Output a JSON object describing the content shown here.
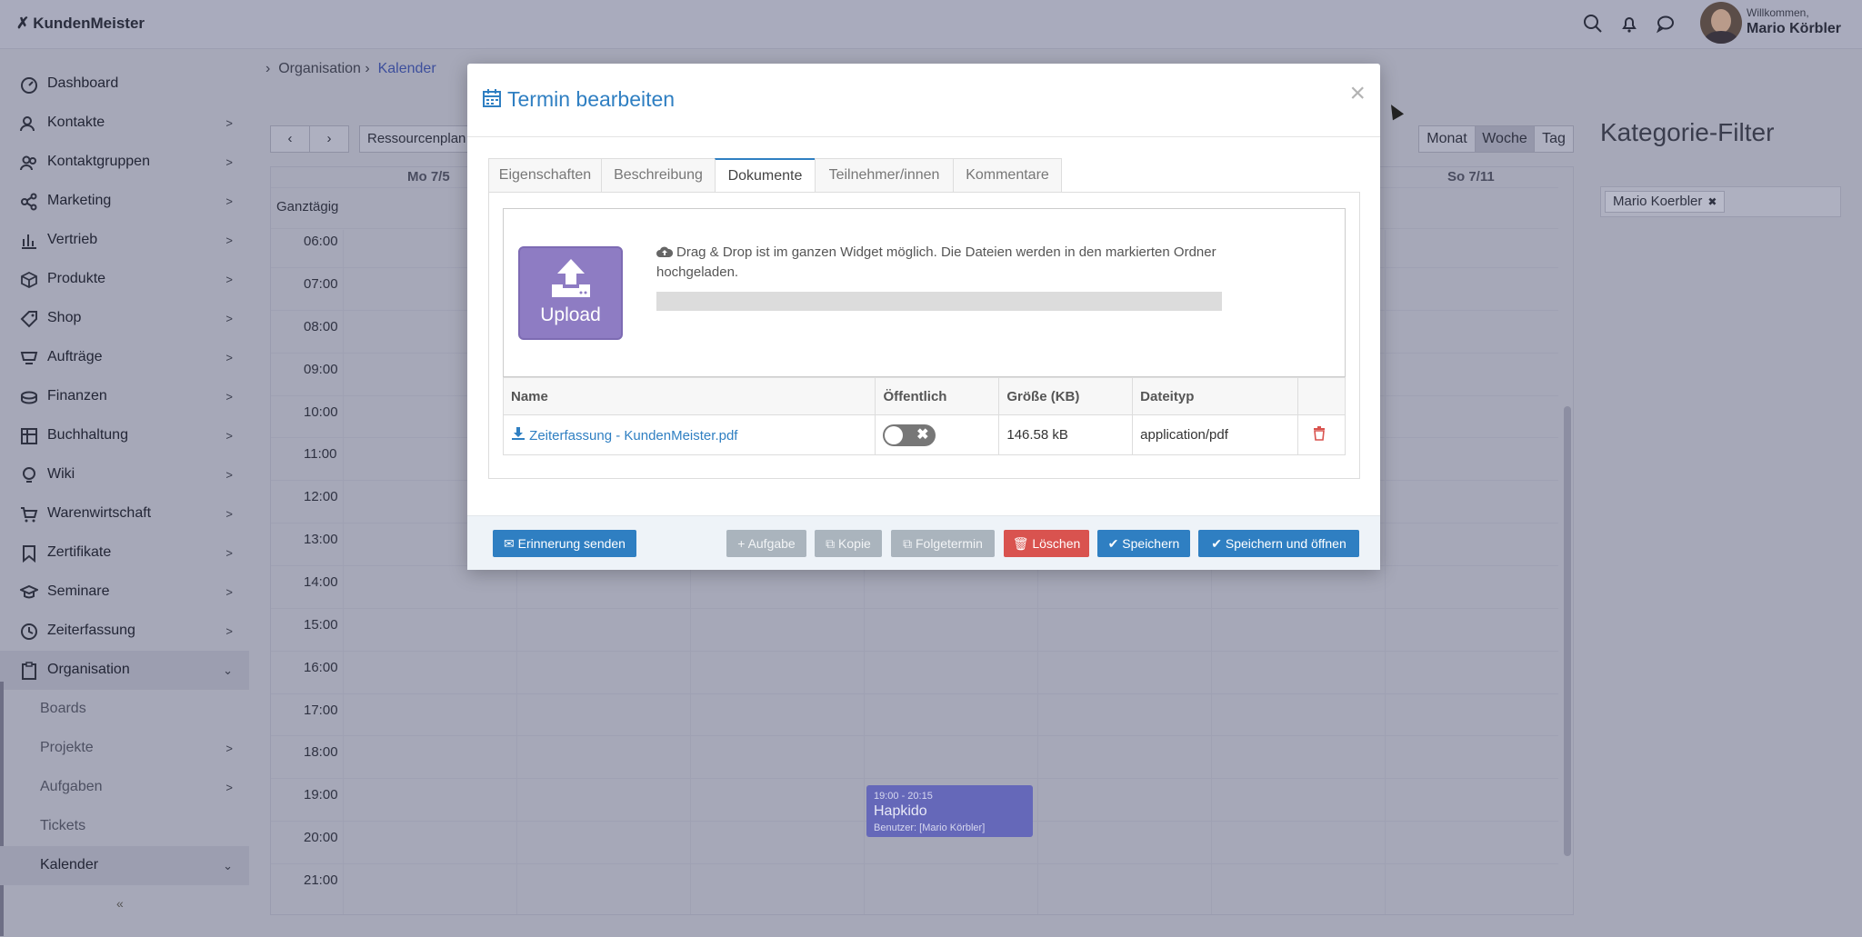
{
  "app": {
    "name": "KundenMeister"
  },
  "header": {
    "welcome": "Willkommen,",
    "user_name": "Mario Körbler",
    "icons": [
      "search-icon",
      "bell-icon",
      "chat-icon"
    ]
  },
  "sidebar": {
    "items": [
      {
        "label": "Dashboard",
        "icon": "dashboard-icon"
      },
      {
        "label": "Kontakte",
        "icon": "contacts-icon"
      },
      {
        "label": "Kontaktgruppen",
        "icon": "groups-icon"
      },
      {
        "label": "Marketing",
        "icon": "marketing-icon"
      },
      {
        "label": "Vertrieb",
        "icon": "chart-icon"
      },
      {
        "label": "Produkte",
        "icon": "box-icon"
      },
      {
        "label": "Shop",
        "icon": "tag-icon"
      },
      {
        "label": "Aufträge",
        "icon": "orders-icon"
      },
      {
        "label": "Finanzen",
        "icon": "coins-icon"
      },
      {
        "label": "Buchhaltung",
        "icon": "table-icon"
      },
      {
        "label": "Wiki",
        "icon": "bulb-icon"
      },
      {
        "label": "Warenwirtschaft",
        "icon": "cart-icon"
      },
      {
        "label": "Zertifikate",
        "icon": "bookmark-icon"
      },
      {
        "label": "Seminare",
        "icon": "graduation-icon"
      },
      {
        "label": "Zeiterfassung",
        "icon": "clock-icon"
      },
      {
        "label": "Organisation",
        "icon": "clipboard-icon"
      }
    ],
    "sub_items": [
      {
        "label": "Boards"
      },
      {
        "label": "Projekte"
      },
      {
        "label": "Aufgaben"
      },
      {
        "label": "Tickets"
      },
      {
        "label": "Kalender"
      }
    ],
    "collapse_label": "«"
  },
  "breadcrumb": {
    "parent": "Organisation",
    "current": "Kalender"
  },
  "calendar": {
    "resource_button": "Ressourcenplan",
    "views": [
      "Monat",
      "Woche",
      "Tag"
    ],
    "active_view": "Woche",
    "day_headers": [
      "Mo 7/5",
      "So 7/11"
    ],
    "allday_label": "Ganztägig",
    "times": [
      "06:00",
      "07:00",
      "08:00",
      "09:00",
      "10:00",
      "11:00",
      "12:00",
      "13:00",
      "14:00",
      "15:00",
      "16:00",
      "17:00",
      "18:00",
      "19:00",
      "20:00",
      "21:00"
    ],
    "event": {
      "time": "19:00 - 20:15",
      "title": "Hapkido",
      "user": "Benutzer: [Mario Körbler]"
    }
  },
  "filter": {
    "title": "Kategorie-Filter",
    "tag": "Mario Koerbler"
  },
  "modal": {
    "title": "Termin bearbeiten",
    "tabs": [
      "Eigenschaften",
      "Beschreibung",
      "Dokumente",
      "Teilnehmer/innen",
      "Kommentare"
    ],
    "active_tab": "Dokumente",
    "upload_label": "Upload",
    "dropzone_text": "Drag & Drop ist im ganzen Widget möglich. Die Dateien werden in den markierten Ordner hochgeladen.",
    "table": {
      "headers": [
        "Name",
        "Öffentlich",
        "Größe (KB)",
        "Dateityp"
      ],
      "rows": [
        {
          "name": "Zeiterfassung - KundenMeister.pdf",
          "public": false,
          "size": "146.58 kB",
          "type": "application/pdf"
        }
      ]
    },
    "footer": {
      "reminder": "Erinnerung senden",
      "task": "Aufgabe",
      "copy": "Kopie",
      "followup": "Folgetermin",
      "delete": "Löschen",
      "save": "Speichern",
      "save_open": "Speichern und öffnen"
    }
  }
}
